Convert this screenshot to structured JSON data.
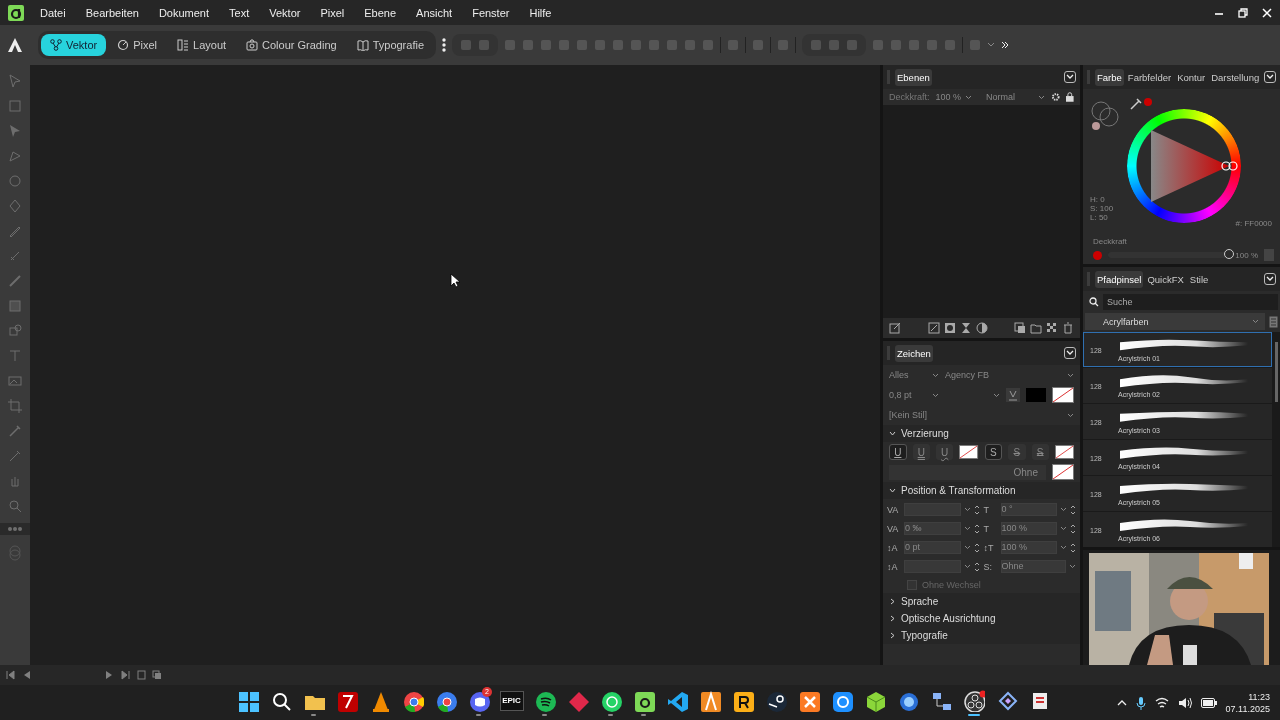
{
  "menu": {
    "items": [
      "Datei",
      "Bearbeiten",
      "Dokument",
      "Text",
      "Vektor",
      "Pixel",
      "Ebene",
      "Ansicht",
      "Fenster",
      "Hilfe"
    ]
  },
  "toolbar": {
    "personas": [
      {
        "label": "Vektor",
        "kind": "vector",
        "selected": true
      },
      {
        "label": "Pixel",
        "kind": "pixel",
        "selected": false
      },
      {
        "label": "Layout",
        "kind": "layout",
        "selected": false
      },
      {
        "label": "Colour Grading",
        "kind": "grading",
        "selected": false
      },
      {
        "label": "Typografie",
        "kind": "type",
        "selected": false
      }
    ]
  },
  "layers_panel": {
    "tabs": [
      {
        "label": "Ebenen",
        "selected": true
      }
    ],
    "opacity_label": "Deckkraft:",
    "opacity": "100 %",
    "blend_mode": "Normal"
  },
  "character_panel": {
    "tabs": [
      {
        "label": "Zeichen",
        "selected": true
      }
    ],
    "scope": "Alles",
    "font": "Agency FB",
    "size": "0,8 pt",
    "style": "[Kein Stil]",
    "sections": [
      {
        "title": "Verzierung",
        "expanded": true,
        "kind": "decoration",
        "underline_labels": [
          "U",
          "U",
          "U"
        ],
        "strike_labels": [
          "S",
          "S",
          "S"
        ],
        "fill": "Ohne"
      },
      {
        "title": "Position & Transformation",
        "expanded": true,
        "kind": "position",
        "fields": [
          {
            "symbol": "VA",
            "kind": "spin"
          },
          {
            "symbol": "T",
            "kind": "spin",
            "value": "0 °"
          },
          {
            "symbol": "VA",
            "kind": "spin",
            "value": "0 ‰"
          },
          {
            "symbol": "T",
            "kind": "spin",
            "value": "100 %"
          },
          {
            "symbol": "↕A",
            "kind": "spin",
            "value": "0 pt"
          },
          {
            "symbol": "↕T",
            "kind": "spin",
            "value": "100 %"
          },
          {
            "symbol": "↕A",
            "kind": "spin"
          },
          {
            "symbol": "S:",
            "kind": "dropdown",
            "value": "Ohne"
          }
        ],
        "checkbox": {
          "label": "Ohne Wechsel",
          "checked": false
        }
      },
      {
        "title": "Sprache",
        "expanded": false
      },
      {
        "title": "Optische Ausrichtung",
        "expanded": false
      },
      {
        "title": "Typografie",
        "expanded": false
      }
    ]
  },
  "color_panel": {
    "tabs": [
      {
        "label": "Farbe",
        "selected": true
      },
      {
        "label": "Farbfelder",
        "selected": false
      },
      {
        "label": "Kontur",
        "selected": false
      },
      {
        "label": "Darstellung",
        "selected": false
      }
    ],
    "hsl": [
      "H: 0",
      "S: 100",
      "L: 50"
    ],
    "hex": "#: FF0000",
    "opacity_label": "Deckkraft",
    "opacity": "100 %",
    "level": 1
  },
  "brushes_panel": {
    "tabs": [
      {
        "label": "Pfadpinsel",
        "selected": true
      },
      {
        "label": "QuickFX",
        "selected": false
      },
      {
        "label": "Stile",
        "selected": false
      }
    ],
    "search": {
      "placeholder": "Suche"
    },
    "category": "Acrylfarben",
    "brushes": [
      {
        "size": "128",
        "name": "Acrylstrich 01",
        "selected": true
      },
      {
        "size": "128",
        "name": "Acrylstrich 02",
        "selected": false
      },
      {
        "size": "128",
        "name": "Acrylstrich 03",
        "selected": false
      },
      {
        "size": "128",
        "name": "Acrylstrich 04",
        "selected": false
      },
      {
        "size": "128",
        "name": "Acrylstrich 05",
        "selected": false
      },
      {
        "size": "128",
        "name": "Acrylstrich 06",
        "selected": false
      }
    ]
  },
  "taskbar": {
    "apps": [
      {
        "kind": "windows",
        "running": false
      },
      {
        "kind": "search",
        "running": false
      },
      {
        "kind": "folder",
        "running": true
      },
      {
        "kind": "filezilla",
        "running": false
      },
      {
        "kind": "vlc",
        "running": false
      },
      {
        "kind": "chrome",
        "running": false
      },
      {
        "kind": "chrome-alt",
        "running": false
      },
      {
        "kind": "discord",
        "running": true,
        "badge": "2"
      },
      {
        "kind": "epic",
        "running": false,
        "label": "EPIC"
      },
      {
        "kind": "spotify",
        "running": true
      },
      {
        "kind": "diamond",
        "running": false
      },
      {
        "kind": "whatsapp",
        "running": true
      },
      {
        "kind": "affinity",
        "running": true
      },
      {
        "kind": "vscode",
        "running": false
      },
      {
        "kind": "fl",
        "running": false
      },
      {
        "kind": "rockstar",
        "running": false
      },
      {
        "kind": "steam",
        "running": false
      },
      {
        "kind": "xampp",
        "running": false
      },
      {
        "kind": "clip",
        "running": false
      },
      {
        "kind": "cube",
        "running": false
      },
      {
        "kind": "orb",
        "running": false
      },
      {
        "kind": "network",
        "running": false
      },
      {
        "kind": "obs",
        "running": true,
        "selected": true
      },
      {
        "kind": "layers",
        "running": false
      },
      {
        "kind": "tool",
        "running": false
      }
    ],
    "time": "11:23",
    "date": "07.11.2025"
  }
}
